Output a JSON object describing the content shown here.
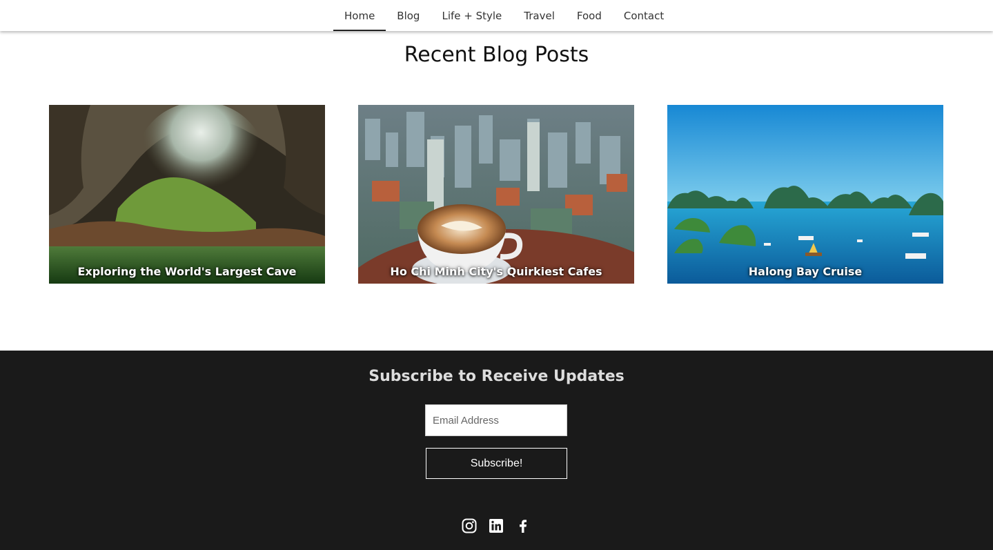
{
  "nav": {
    "items": [
      {
        "label": "Home",
        "active": true
      },
      {
        "label": "Blog"
      },
      {
        "label": "Life + Style"
      },
      {
        "label": "Travel"
      },
      {
        "label": "Food"
      },
      {
        "label": "Contact"
      }
    ]
  },
  "main": {
    "title": "Recent Blog Posts",
    "posts": [
      {
        "title": "Exploring the World's Largest Cave",
        "image": "cave-photo"
      },
      {
        "title": "Ho Chi Minh City's Quirkiest Cafes",
        "image": "city-cafe-photo"
      },
      {
        "title": "Halong Bay Cruise",
        "image": "halong-bay-photo"
      }
    ]
  },
  "footer": {
    "title": "Subscribe to Receive Updates",
    "email_placeholder": "Email Address",
    "subscribe_label": "Subscribe!",
    "social": [
      "instagram-icon",
      "linkedin-icon",
      "facebook-icon"
    ]
  },
  "colors": {
    "footer_bg": "#1a1a1a",
    "text": "#333333"
  }
}
